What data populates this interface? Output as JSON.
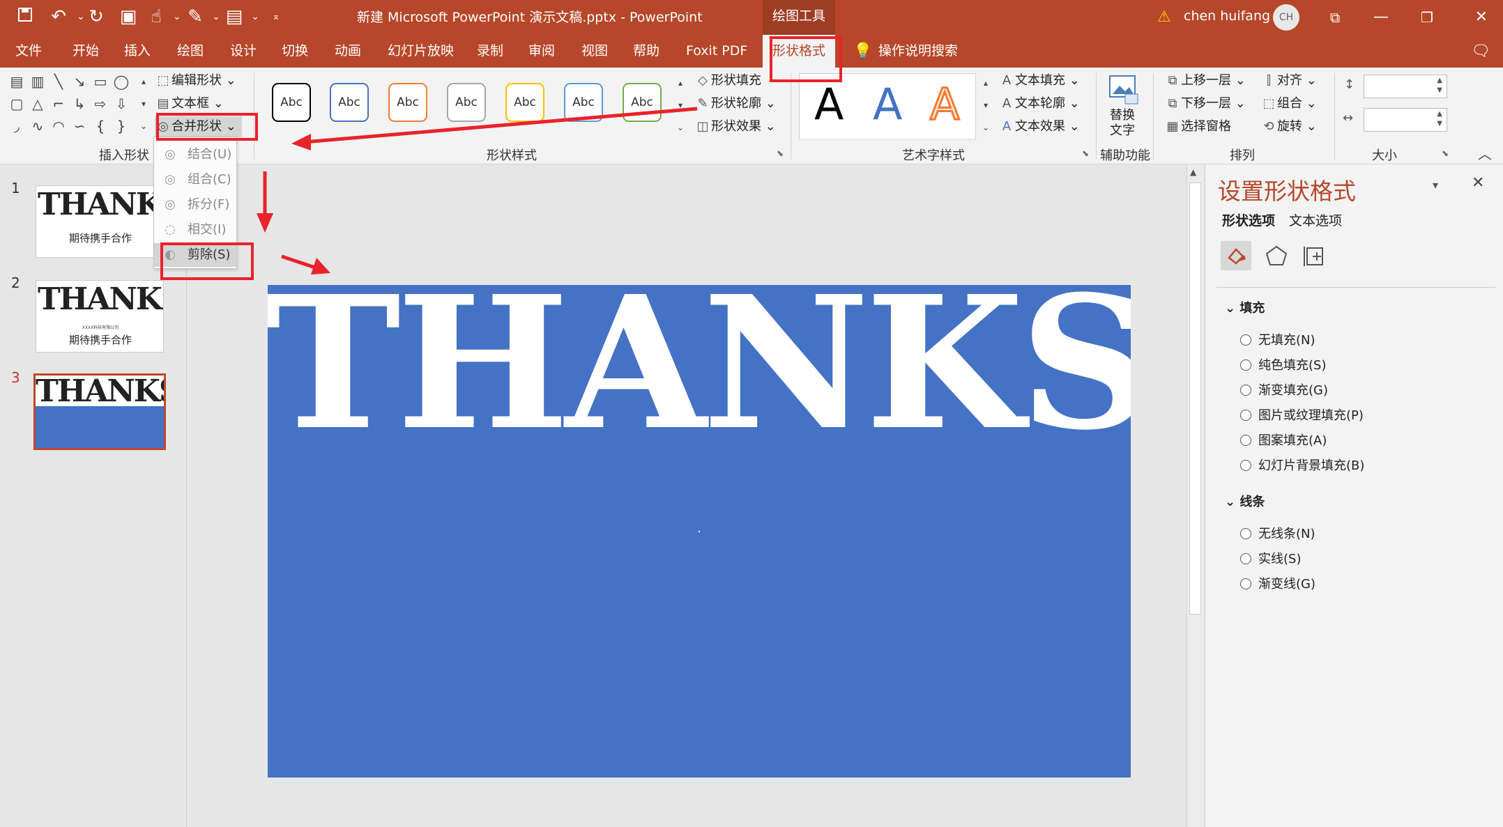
{
  "titlebar": {
    "doc_title": "新建 Microsoft PowerPoint 演示文稿.pptx  -  PowerPoint",
    "context_group": "绘图工具",
    "user_name": "chen huifang",
    "user_initials": "CH"
  },
  "tabs": [
    "文件",
    "开始",
    "插入",
    "绘图",
    "设计",
    "切换",
    "动画",
    "幻灯片放映",
    "录制",
    "审阅",
    "视图",
    "帮助",
    "Foxit PDF",
    "形状格式"
  ],
  "search_label": "操作说明搜索",
  "ribbon": {
    "insert_shapes": {
      "edit_shape": "编辑形状",
      "text_box": "文本框",
      "merge_shapes": "合并形状",
      "group_label": "插入形状"
    },
    "shape_styles": {
      "sample_text": "Abc",
      "sample_colors": [
        "#000000",
        "#4472c4",
        "#ed7d31",
        "#a5a5a5",
        "#ffc000",
        "#5b9bd5",
        "#70ad47"
      ],
      "fill": "形状填充",
      "outline": "形状轮廓",
      "effects": "形状效果",
      "group_label": "形状样式"
    },
    "wordart": {
      "sample": "A",
      "text_fill": "文本填充",
      "text_outline": "文本轮廓",
      "text_effects": "文本效果",
      "group_label": "艺术字样式"
    },
    "accessibility": {
      "alt_text_line1": "替换",
      "alt_text_line2": "文字",
      "group_label": "辅助功能"
    },
    "arrange": {
      "bring_forward": "上移一层",
      "send_backward": "下移一层",
      "selection_pane": "选择窗格",
      "align": "对齐",
      "group": "组合",
      "rotate": "旋转",
      "group_label": "排列"
    },
    "size": {
      "group_label": "大小"
    }
  },
  "merge_menu": [
    "结合(U)",
    "组合(C)",
    "拆分(F)",
    "相交(I)",
    "剪除(S)"
  ],
  "slides": [
    {
      "num": "1",
      "word": "THANKS",
      "subtitle": "期待携手合作"
    },
    {
      "num": "2",
      "word": "THANKS",
      "small": "XXXX科技有限公司",
      "subtitle": "期待携手合作"
    },
    {
      "num": "3",
      "word": "THANKS"
    }
  ],
  "main_slide": {
    "word": "THANKS",
    "bg_color": "#4472c4"
  },
  "format_pane": {
    "title": "设置形状格式",
    "tab_shape": "形状选项",
    "tab_text": "文本选项",
    "fill_header": "填充",
    "fill_options": [
      "无填充(N)",
      "纯色填充(S)",
      "渐变填充(G)",
      "图片或纹理填充(P)",
      "图案填充(A)",
      "幻灯片背景填充(B)"
    ],
    "line_header": "线条",
    "line_options": [
      "无线条(N)",
      "实线(S)",
      "渐变线(G)"
    ]
  },
  "accent_color": "#b7472a",
  "highlight_color": "#e8232a"
}
